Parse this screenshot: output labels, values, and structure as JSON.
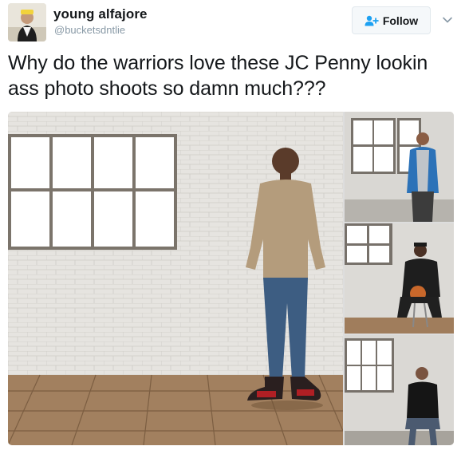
{
  "user": {
    "display_name": "young alfajore",
    "handle": "@bucketsdntlie",
    "avatar_icon": "avatar-photo"
  },
  "follow_button": {
    "label": "Follow",
    "icon": "add-user-icon",
    "icon_color": "#1da1f2"
  },
  "menu": {
    "icon": "chevron-down-icon"
  },
  "tweet": {
    "text": "Why do the warriors love these JC Penny lookin ass photo shoots so damn much???"
  },
  "media": {
    "photos": [
      {
        "name": "photo-player-standing"
      },
      {
        "name": "photo-player-blue-hoodie"
      },
      {
        "name": "photo-player-basketball-stool"
      },
      {
        "name": "photo-player-black-jacket-stool"
      }
    ]
  },
  "colors": {
    "text": "#14171a",
    "secondary_text": "#8899a6",
    "button_bg": "#f5f8fa",
    "button_border": "#e1e8ed",
    "accent": "#1da1f2"
  }
}
